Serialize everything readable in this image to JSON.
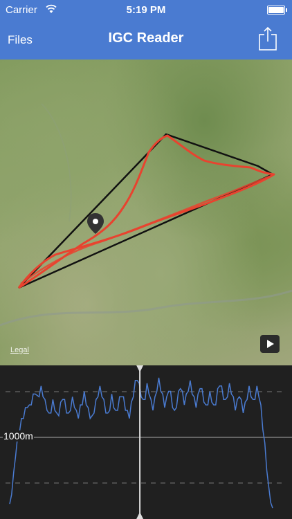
{
  "status_bar": {
    "carrier": "Carrier",
    "time": "5:19 PM",
    "battery_level": 1.0
  },
  "nav_bar": {
    "back_label": "Files",
    "title": "IGC Reader",
    "share_icon": "share-icon"
  },
  "map": {
    "legal_label": "Legal",
    "play_icon": "play-icon",
    "pin_icon": "map-pin-icon"
  },
  "chart_data": {
    "type": "line",
    "ylabel_tick": "1000m",
    "series": [
      {
        "color": "#4a7bd1"
      }
    ],
    "profile": [
      0.05,
      0.12,
      0.28,
      0.42,
      0.52,
      0.6,
      0.66,
      0.7,
      0.74,
      0.78,
      0.76,
      0.8,
      0.84,
      0.88,
      0.83,
      0.86,
      0.9,
      0.86,
      0.8,
      0.76,
      0.7,
      0.74,
      0.8,
      0.76,
      0.7,
      0.72,
      0.78,
      0.84,
      0.8,
      0.74,
      0.7,
      0.76,
      0.82,
      0.78,
      0.72,
      0.7,
      0.76,
      0.8,
      0.86,
      0.8,
      0.74,
      0.7,
      0.68,
      0.74,
      0.8,
      0.86,
      0.9,
      0.86,
      0.8,
      0.74,
      0.7,
      0.76,
      0.84,
      0.78,
      0.72,
      0.76,
      0.82,
      0.86,
      0.82,
      0.76,
      0.72,
      0.7,
      0.78,
      0.86,
      0.94,
      0.98,
      0.92,
      0.86,
      0.8,
      0.84,
      0.92,
      0.88,
      0.8,
      0.76,
      0.82,
      0.9,
      0.96,
      0.9,
      0.84,
      0.78,
      0.82,
      0.9,
      0.86,
      0.78,
      0.72,
      0.78,
      0.86,
      0.92,
      0.86,
      0.8,
      0.84,
      0.9,
      0.94,
      0.88,
      0.82,
      0.78,
      0.84,
      0.92,
      0.88,
      0.82,
      0.76,
      0.8,
      0.86,
      0.82,
      0.76,
      0.8,
      0.88,
      0.94,
      0.9,
      0.84,
      0.8,
      0.86,
      0.92,
      0.88,
      0.82,
      0.76,
      0.8,
      0.86,
      0.8,
      0.74,
      0.78,
      0.84,
      0.9,
      0.86,
      0.8,
      0.84,
      0.9,
      0.86,
      0.76,
      0.62,
      0.48,
      0.32,
      0.18,
      0.06,
      0.02
    ],
    "cursor_position": 0.495,
    "ylim": [
      0,
      1
    ]
  }
}
